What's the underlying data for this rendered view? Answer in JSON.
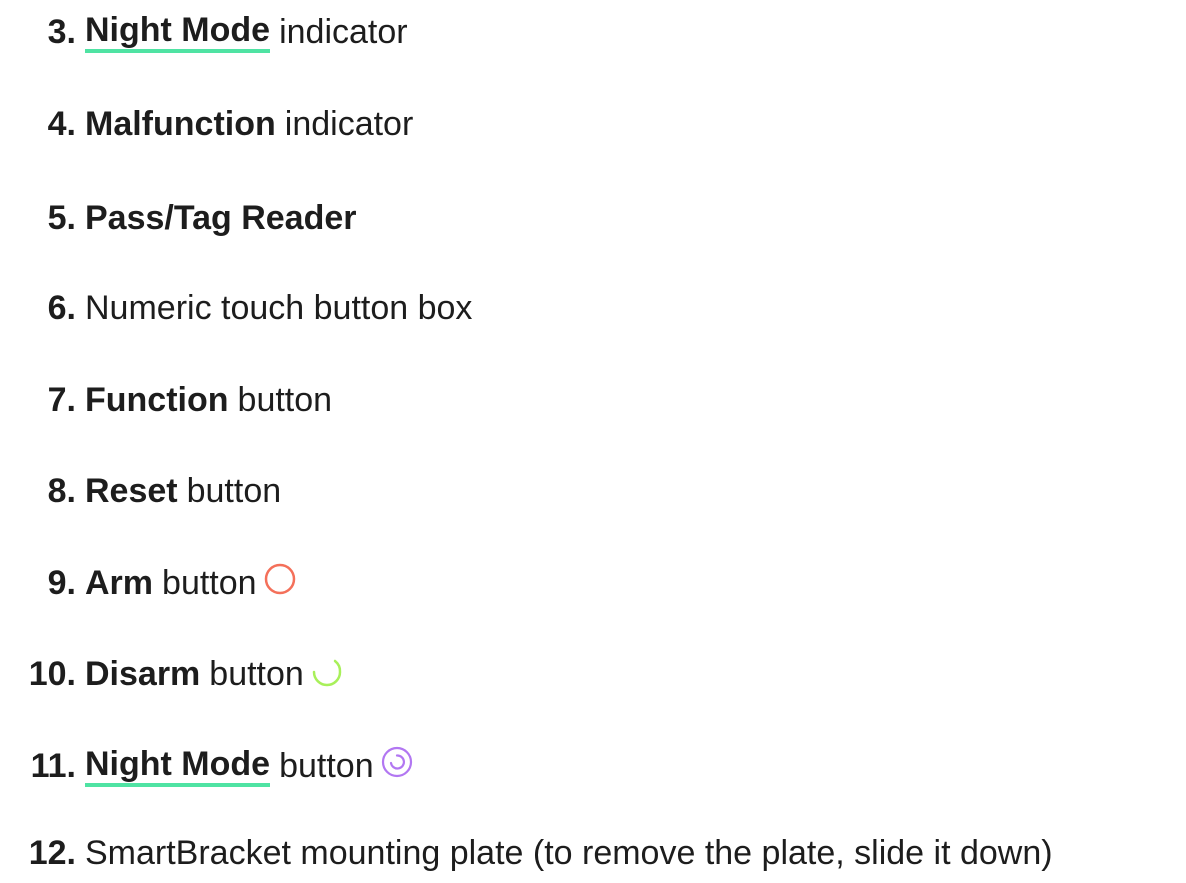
{
  "colors": {
    "text": "#1d1d1d",
    "link_underline": "#4fe3a3",
    "arm_icon": "#f4705a",
    "disarm_icon": "#a8f05a",
    "night_icon": "#b277f2"
  },
  "items": [
    {
      "number": "3.",
      "strong": "Night Mode",
      "rest": "indicator",
      "strong_is_link": true
    },
    {
      "number": "4.",
      "strong": "Malfunction",
      "rest": "indicator"
    },
    {
      "number": "5.",
      "strong": "Pass/Tag Reader"
    },
    {
      "number": "6.",
      "rest": "Numeric touch button box"
    },
    {
      "number": "7.",
      "strong": "Function",
      "rest": "button"
    },
    {
      "number": "8.",
      "strong": "Reset",
      "rest": "button"
    },
    {
      "number": "9.",
      "strong": "Arm",
      "rest": "button",
      "icon": "arm-circle-icon"
    },
    {
      "number": "10.",
      "strong": "Disarm",
      "rest": "button",
      "icon": "disarm-arc-icon"
    },
    {
      "number": "11.",
      "strong": "Night Mode",
      "rest": "button",
      "strong_is_link": true,
      "icon": "night-mode-spiral-icon"
    },
    {
      "number": "12.",
      "rest": "SmartBracket mounting plate (to remove the plate, slide it down)"
    }
  ]
}
